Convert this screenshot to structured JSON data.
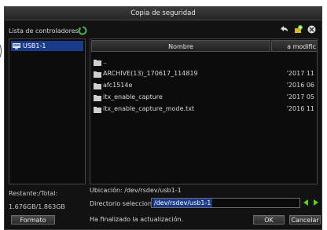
{
  "window": {
    "title": "Copia de seguridad"
  },
  "controllers": {
    "label": "Lista de controladores:",
    "items": [
      {
        "label": "USB1-1"
      }
    ]
  },
  "file_table": {
    "columns": [
      "Nombre",
      "a modific"
    ],
    "rows": [
      {
        "name": "..",
        "date": ""
      },
      {
        "name": "ARCHIVE(13)_170617_114819",
        "date": "'2017 11"
      },
      {
        "name": "afc1514e",
        "date": "'2016 06"
      },
      {
        "name": "itx_enable_capture",
        "date": "'2017 05"
      },
      {
        "name": "itx_enable_capture_mode.txt",
        "date": "'2016 11"
      }
    ]
  },
  "storage": {
    "label": "Restante:/Total:",
    "value": "1.676GB/1.863GB"
  },
  "location": {
    "text": "Ubicación: /dev/rsdev/usb1-1"
  },
  "selected_dir": {
    "label": "Directorio seleccionado:",
    "value": "/dev/rsdev/usb1-1"
  },
  "status": {
    "text": "Ha finalizado la actualización."
  },
  "buttons": {
    "format": "Formato",
    "ok": "OK",
    "cancel": "Cancelar"
  },
  "icons": {
    "refresh": "refresh-icon",
    "back": "back-arrow-icon",
    "new_folder": "new-folder-icon",
    "delete": "delete-icon",
    "usb": "usb-drive-icon",
    "folder": "folder-icon"
  },
  "colors": {
    "accent": "#1a3a8c",
    "nav_arrow": "#5ad21e",
    "refresh": "#4caf50"
  }
}
